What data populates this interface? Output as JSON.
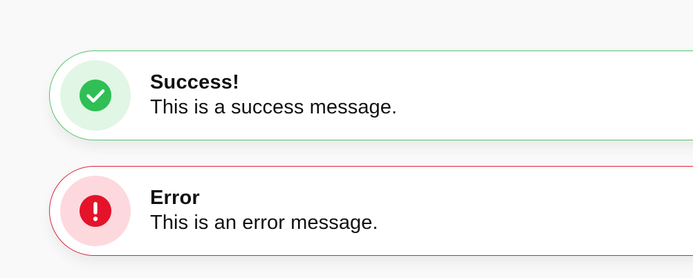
{
  "toasts": [
    {
      "kind": "success",
      "icon": "check-circle-icon",
      "title": "Success!",
      "message": "This is a success message.",
      "accent": "#2fbf54",
      "border": "#52c46a",
      "icon_bg": "#e1f6e5"
    },
    {
      "kind": "error",
      "icon": "exclamation-circle-icon",
      "title": "Error",
      "message": "This is an error message.",
      "accent": "#e4132a",
      "border": "#d9233a",
      "icon_bg": "#fdd9de"
    }
  ]
}
